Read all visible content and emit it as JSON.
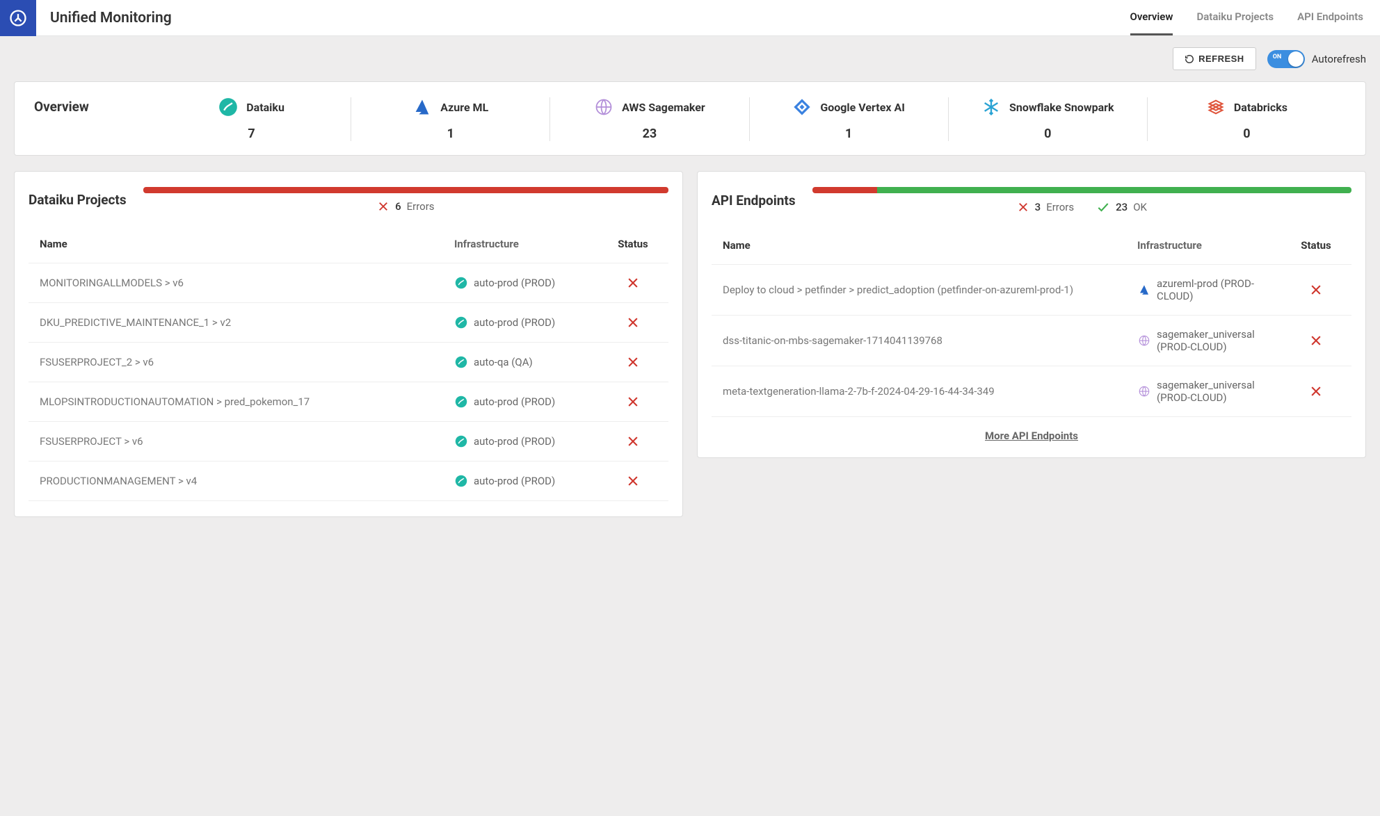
{
  "header": {
    "title": "Unified Monitoring",
    "tabs": [
      {
        "label": "Overview",
        "active": true
      },
      {
        "label": "Dataiku Projects",
        "active": false
      },
      {
        "label": "API Endpoints",
        "active": false
      }
    ]
  },
  "toolbar": {
    "refresh_label": "REFRESH",
    "autorefresh_label": "Autorefresh",
    "toggle_on_label": "ON"
  },
  "overview": {
    "title": "Overview",
    "platforms": [
      {
        "name": "Dataiku",
        "count": "7",
        "icon": "dataiku"
      },
      {
        "name": "Azure ML",
        "count": "1",
        "icon": "azure"
      },
      {
        "name": "AWS Sagemaker",
        "count": "23",
        "icon": "sagemaker"
      },
      {
        "name": "Google Vertex AI",
        "count": "1",
        "icon": "vertex"
      },
      {
        "name": "Snowflake Snowpark",
        "count": "0",
        "icon": "snowflake"
      },
      {
        "name": "Databricks",
        "count": "0",
        "icon": "databricks"
      }
    ]
  },
  "projects_panel": {
    "title": "Dataiku Projects",
    "errors_count": "6",
    "errors_label": "Errors",
    "bar_red_pct": 100,
    "bar_green_pct": 0,
    "columns": {
      "name": "Name",
      "infra": "Infrastructure",
      "status": "Status"
    },
    "rows": [
      {
        "name": "MONITORINGALLMODELS > v6",
        "infra": "auto-prod (PROD)",
        "infra_icon": "dataiku",
        "status": "error"
      },
      {
        "name": "DKU_PREDICTIVE_MAINTENANCE_1 > v2",
        "infra": "auto-prod (PROD)",
        "infra_icon": "dataiku",
        "status": "error"
      },
      {
        "name": "FSUSERPROJECT_2 > v6",
        "infra": "auto-qa (QA)",
        "infra_icon": "dataiku",
        "status": "error"
      },
      {
        "name": "MLOPSINTRODUCTIONAUTOMATION > pred_pokemon_17",
        "infra": "auto-prod (PROD)",
        "infra_icon": "dataiku",
        "status": "error"
      },
      {
        "name": "FSUSERPROJECT > v6",
        "infra": "auto-prod (PROD)",
        "infra_icon": "dataiku",
        "status": "error"
      },
      {
        "name": "PRODUCTIONMANAGEMENT > v4",
        "infra": "auto-prod (PROD)",
        "infra_icon": "dataiku",
        "status": "error"
      }
    ]
  },
  "endpoints_panel": {
    "title": "API Endpoints",
    "errors_count": "3",
    "errors_label": "Errors",
    "ok_count": "23",
    "ok_label": "OK",
    "bar_red_pct": 12,
    "bar_green_pct": 88,
    "columns": {
      "name": "Name",
      "infra": "Infrastructure",
      "status": "Status"
    },
    "rows": [
      {
        "name": "Deploy to cloud > petfinder > predict_adoption (petfinder-on-azureml-prod-1)",
        "infra": "azureml-prod (PROD-CLOUD)",
        "infra_icon": "azure",
        "status": "error"
      },
      {
        "name": "dss-titanic-on-mbs-sagemaker-1714041139768",
        "infra": "sagemaker_universal (PROD-CLOUD)",
        "infra_icon": "sagemaker",
        "status": "error"
      },
      {
        "name": "meta-textgeneration-llama-2-7b-f-2024-04-29-16-44-34-349",
        "infra": "sagemaker_universal (PROD-CLOUD)",
        "infra_icon": "sagemaker",
        "status": "error"
      }
    ],
    "more_link": "More API Endpoints"
  },
  "colors": {
    "error": "#cf352c",
    "ok": "#40b04f",
    "accent": "#2b4db3"
  }
}
